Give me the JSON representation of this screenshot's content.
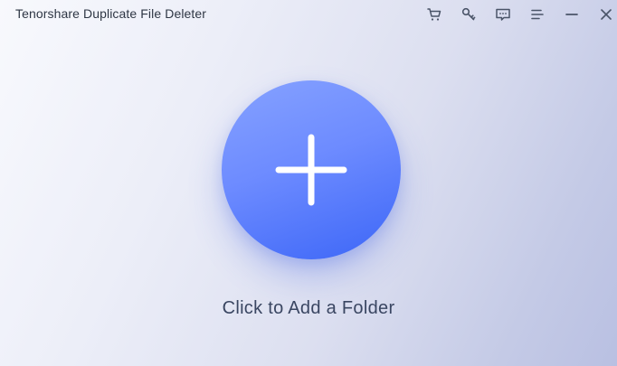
{
  "window": {
    "title": "Tenorshare Duplicate File Deleter"
  },
  "toolbar": {
    "buttons": [
      {
        "icon": "cart-icon"
      },
      {
        "icon": "key-icon"
      },
      {
        "icon": "feedback-icon"
      },
      {
        "icon": "menu-icon"
      },
      {
        "icon": "minimize-icon"
      },
      {
        "icon": "close-icon"
      }
    ]
  },
  "main": {
    "add_label": "Click to Add a Folder",
    "add_icon": "plus-icon"
  },
  "colors": {
    "accent": "#5a7cff",
    "accent_dark": "#3c66f7",
    "text": "#3a4662",
    "icon": "#4a5468"
  }
}
